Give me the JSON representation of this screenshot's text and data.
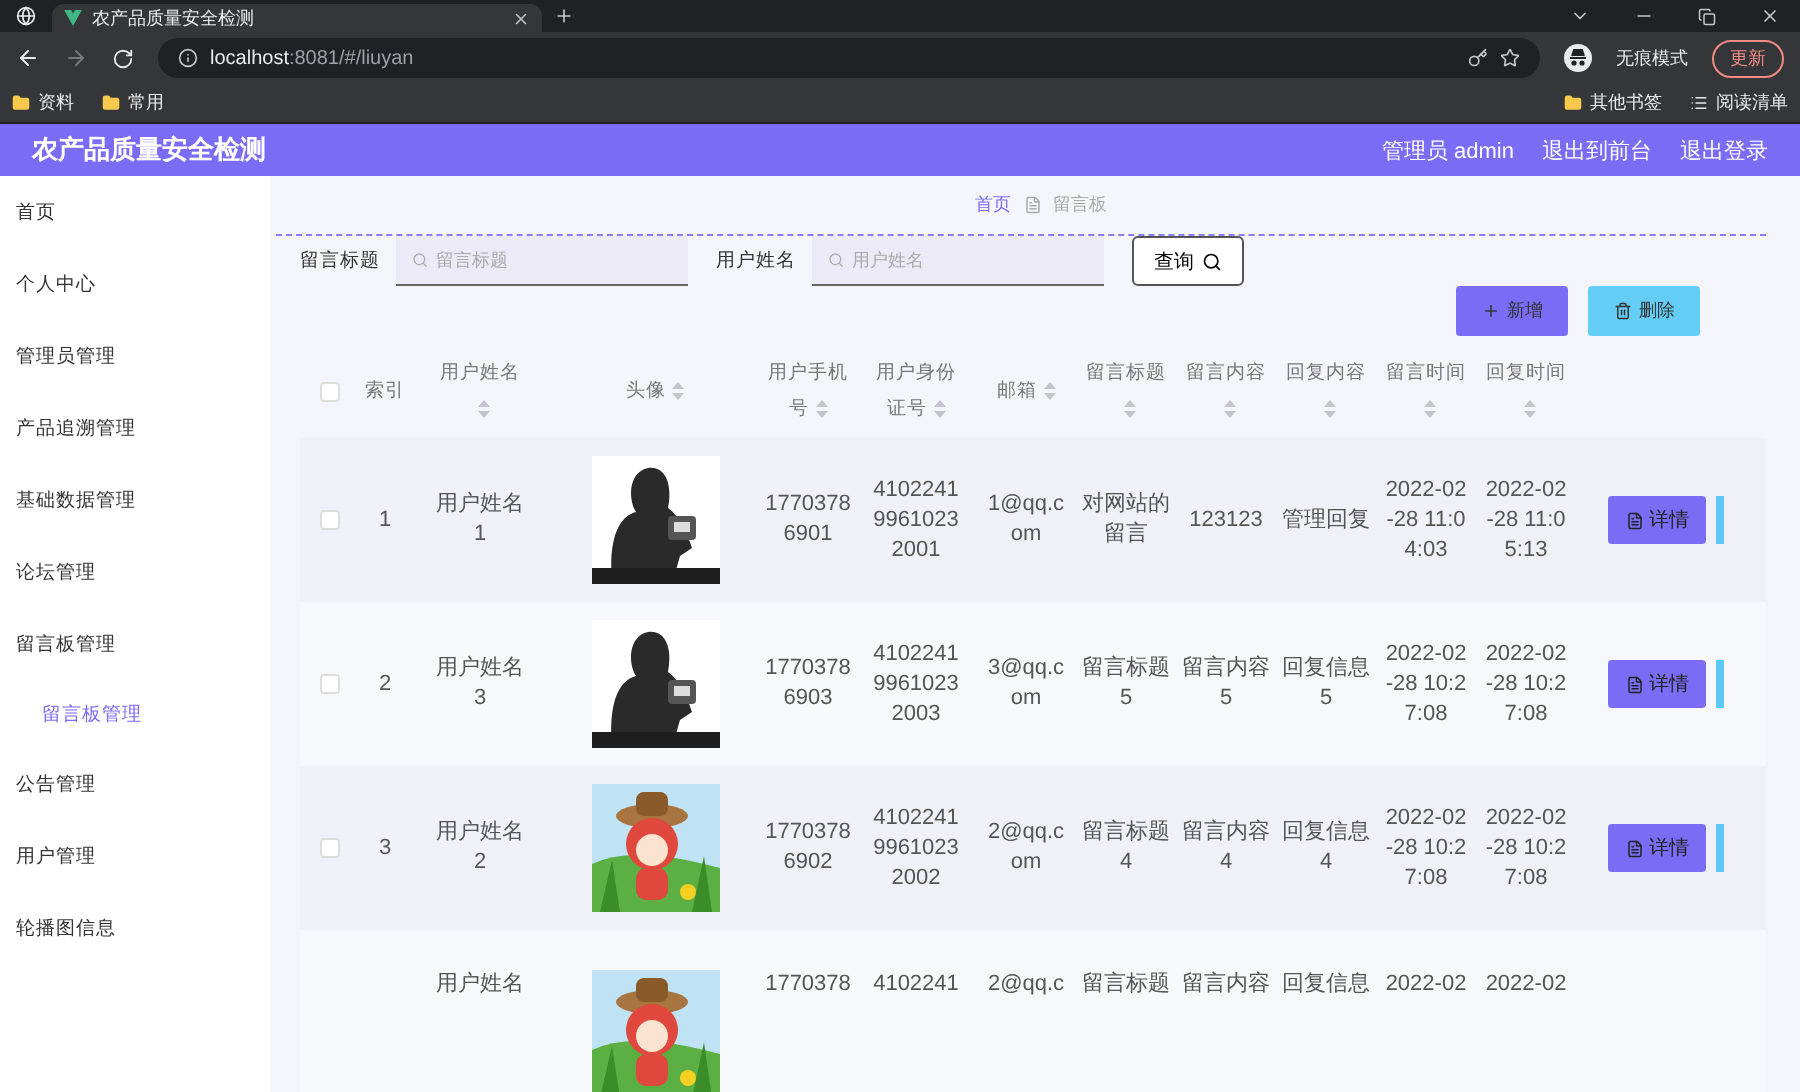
{
  "browser": {
    "tab_title": "农产品质量安全检测",
    "url_host": "localhost",
    "url_rest": ":8081/#/liuyan",
    "incognito_label": "无痕模式",
    "update_label": "更新",
    "bookmarks": [
      "资料",
      "常用"
    ],
    "right_bookmarks": [
      {
        "kind": "folder",
        "label": "其他书签"
      },
      {
        "kind": "list",
        "label": "阅读清单"
      }
    ]
  },
  "header": {
    "title": "农产品质量安全检测",
    "user": "管理员 admin",
    "links": [
      "退出到前台",
      "退出登录"
    ]
  },
  "sidebar": {
    "items": [
      {
        "label": "首页"
      },
      {
        "label": "个人中心"
      },
      {
        "label": "管理员管理"
      },
      {
        "label": "产品追溯管理"
      },
      {
        "label": "基础数据管理"
      },
      {
        "label": "论坛管理"
      },
      {
        "label": "留言板管理",
        "children": [
          {
            "label": "留言板管理",
            "selected": true
          }
        ]
      },
      {
        "label": "公告管理"
      },
      {
        "label": "用户管理"
      },
      {
        "label": "轮播图信息"
      }
    ]
  },
  "breadcrumb": [
    "首页",
    "留言板"
  ],
  "search": {
    "fields": [
      {
        "label": "留言标题",
        "placeholder": "留言标题"
      },
      {
        "label": "用户姓名",
        "placeholder": "用户姓名"
      }
    ],
    "button": "查询"
  },
  "actions": [
    {
      "kind": "add",
      "label": "新增"
    },
    {
      "kind": "delete",
      "label": "删除"
    }
  ],
  "table": {
    "all_checked": false,
    "columns": [
      {
        "label": "索引",
        "sortable": false
      },
      {
        "label": "用户姓名",
        "sortable": true
      },
      {
        "label": "头像",
        "sortable": true
      },
      {
        "label": "用户手机号",
        "sortable": true
      },
      {
        "label": "用户身份证号",
        "sortable": true
      },
      {
        "label": "邮箱",
        "sortable": true
      },
      {
        "label": "留言标题",
        "sortable": true
      },
      {
        "label": "留言内容",
        "sortable": true
      },
      {
        "label": "回复内容",
        "sortable": true
      },
      {
        "label": "留言时间",
        "sortable": true
      },
      {
        "label": "回复时间",
        "sortable": true
      }
    ],
    "rows": [
      {
        "checked": false,
        "index": "1",
        "name": "用户姓名1",
        "phone": "17703786901",
        "id_number": "410224199610232001",
        "email": "1@qq.com",
        "title": "对网站的留言",
        "content": "123123",
        "reply": "管理回复",
        "created": "2022-02-28 11:04:03",
        "replied": "2022-02-28 11:05:13",
        "action": "详情"
      },
      {
        "checked": false,
        "index": "2",
        "name": "用户姓名3",
        "phone": "17703786903",
        "id_number": "410224199610232003",
        "email": "3@qq.com",
        "title": "留言标题5",
        "content": "留言内容5",
        "reply": "回复信息5",
        "created": "2022-02-28 10:27:08",
        "replied": "2022-02-28 10:27:08",
        "action": "详情"
      },
      {
        "checked": false,
        "index": "3",
        "name": "用户姓名2",
        "phone": "17703786902",
        "id_number": "410224199610232002",
        "email": "2@qq.com",
        "title": "留言标题4",
        "content": "留言内容4",
        "reply": "回复信息4",
        "created": "2022-02-28 10:27:08",
        "replied": "2022-02-28 10:27:08",
        "action": "详情"
      },
      {
        "name": "用户姓名",
        "phone": "1770378",
        "id_number": "4102241",
        "email": "2@qq.c",
        "title": "留言标题",
        "content": "留言内容",
        "reply": "回复信息",
        "created": "2022-02",
        "replied": "2022-02"
      }
    ]
  }
}
